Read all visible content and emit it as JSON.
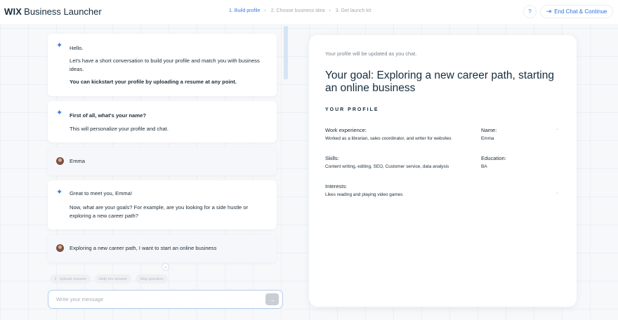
{
  "header": {
    "brand": "WIX",
    "product": "Business Launcher",
    "steps": [
      {
        "label": "1. Build profile"
      },
      {
        "label": "2. Choose business idea"
      },
      {
        "label": "3. Get launch kit"
      }
    ],
    "step_separator": "›",
    "help_label": "?",
    "end_chat_label": "End Chat & Continue"
  },
  "chat": {
    "messages": [
      {
        "sender": "bot",
        "lines": [
          "Hello.",
          "Let's have a short conversation to build your profile and match you with business ideas.",
          "You can kickstart your profile by uploading a resume at any point."
        ]
      },
      {
        "sender": "bot",
        "lines": [
          "First of all, what's your name?",
          "This will personalize your profile and chat."
        ]
      },
      {
        "sender": "user",
        "text": "Emma"
      },
      {
        "sender": "bot",
        "lines": [
          "Great to meet you, Emma!",
          "Now, what are your goals? For example, are you looking for a side hustle or exploring a new career path?"
        ]
      },
      {
        "sender": "user",
        "text": "Exploring a new career path, I want to start an online business"
      }
    ],
    "quick_actions": [
      "Upload resume",
      "Help me answer",
      "Skip question"
    ],
    "input_placeholder": "Write your message"
  },
  "profile": {
    "note": "Your profile will be updated as you chat.",
    "goal": "Your goal: Exploring a new career path, starting an online business",
    "section_title": "YOUR PROFILE",
    "fields": {
      "work_label": "Work experience:",
      "work_value": "Worked as a librarian, sales coordinator, and writer for websites",
      "name_label": "Name:",
      "name_value": "Emma",
      "skills_label": "Skills:",
      "skills_value": "Content writing, editing, SEO, Customer service, data analysis",
      "education_label": "Education:",
      "education_value": "BA",
      "interests_label": "Interests:",
      "interests_value": "Likes reading and playing video games"
    }
  },
  "colors": {
    "accent": "#3a7be8",
    "text": "#20303c",
    "muted": "#a0aab3"
  }
}
